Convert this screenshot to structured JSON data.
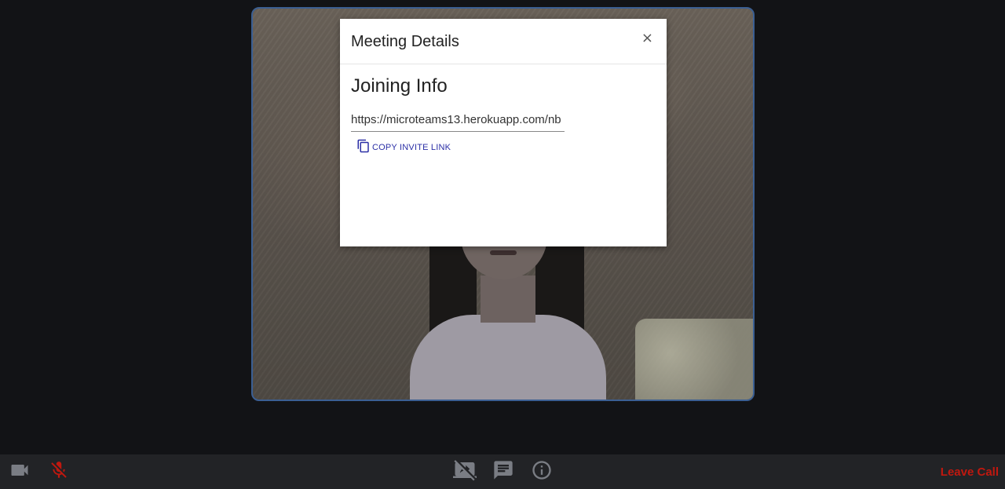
{
  "modal": {
    "title": "Meeting Details",
    "close_label": "×",
    "section_heading": "Joining Info",
    "invite_link_value": "https://microteams13.herokuapp.com/nb",
    "copy_button_label": "COPY INVITE LINK"
  },
  "controls": {
    "camera_icon": "videocam-icon",
    "mic_icon": "mic-off-icon",
    "screen_share_icon": "screen-share-off-icon",
    "chat_icon": "chat-icon",
    "info_icon": "info-icon",
    "leave_label": "Leave Call"
  },
  "colors": {
    "background": "#121316",
    "control_bar": "#222326",
    "video_border": "#3b5f93",
    "mic_off": "#c0180f",
    "leave": "#c0180f",
    "link": "#2b2fa6"
  }
}
